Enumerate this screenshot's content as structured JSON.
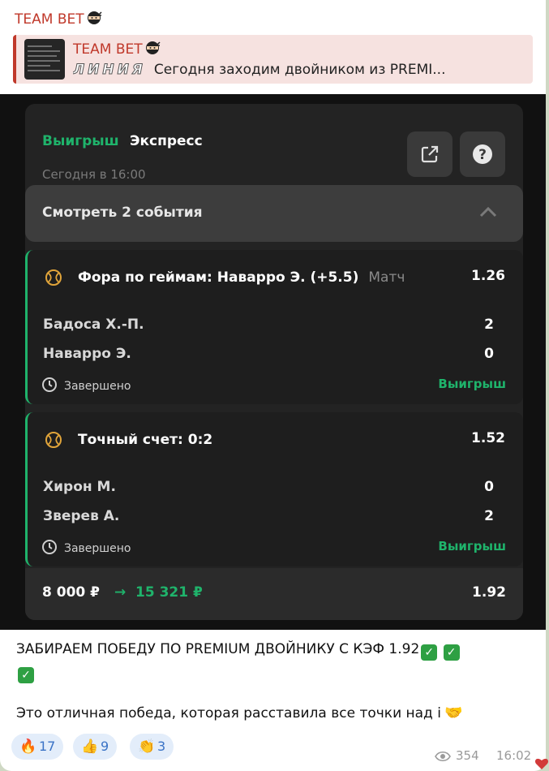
{
  "channel": {
    "name": "TEAM BET"
  },
  "reply": {
    "title": "TEAM BET",
    "prefix": "ЛИНИЯ",
    "text": "Сегодня заходим двойником из PREMI..."
  },
  "bet": {
    "status": "Выигрыш",
    "type": "Экспресс",
    "date": "Сегодня в 16:00",
    "events_toggle": "Смотреть 2 события",
    "events": [
      {
        "title": "Фора по геймам: Наварро Э. (+5.5)",
        "kind": "Матч",
        "odds": "1.26",
        "teams": [
          {
            "name": "Бадоса Х.-П.",
            "score": "2"
          },
          {
            "name": "Наварро Э.",
            "score": "0"
          }
        ],
        "state": "Завершено",
        "result": "Выигрыш"
      },
      {
        "title": "Точный счет: 0:2",
        "kind": "",
        "odds": "1.52",
        "teams": [
          {
            "name": "Хирон М.",
            "score": "0"
          },
          {
            "name": "Зверев А.",
            "score": "2"
          }
        ],
        "state": "Завершено",
        "result": "Выигрыш"
      }
    ],
    "stake": "8 000 ₽",
    "arrow": "→",
    "payout": "15 321 ₽",
    "total_odds": "1.92"
  },
  "message": {
    "line1": "ЗАБИРАЕМ ПОБЕДУ ПО PREMIUM ДВОЙНИКУ С КЭФ 1.92",
    "line2": "Это отличная победа, которая расставила все точки над і"
  },
  "reactions": [
    {
      "emoji": "🔥",
      "count": "17"
    },
    {
      "emoji": "👍",
      "count": "9"
    },
    {
      "emoji": "👏",
      "count": "3"
    }
  ],
  "meta": {
    "views": "354",
    "time": "16:02"
  },
  "colors": {
    "accent_red": "#c0392b",
    "win_green": "#1fb36b",
    "reaction_blue": "#3a73c6"
  },
  "icons": [
    "ninja-icon",
    "share-icon",
    "help-icon",
    "chevron-up-icon",
    "tennis-ball-icon",
    "clock-icon",
    "eye-icon",
    "check-emoji-icon",
    "handshake-emoji-icon"
  ]
}
